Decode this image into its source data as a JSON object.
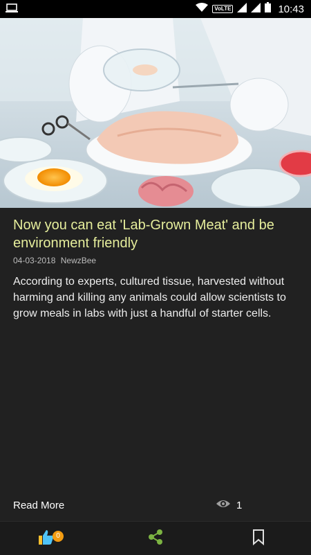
{
  "status_bar": {
    "time": "10:43",
    "network_badge": "VoLTE",
    "icons": [
      "screen-cast-icon",
      "wifi-icon",
      "signal-icon",
      "battery-icon"
    ]
  },
  "article": {
    "headline": "Now you can eat 'Lab-Grown Meat'  and be environment friendly",
    "date": "04-03-2018",
    "source": "NewzBee",
    "summary": "According to experts, cultured tissue, harvested without harming and killing any animals could allow scientists to grow meals in labs with just a handful of starter cells.",
    "read_more_label": "Read More",
    "view_count": "1",
    "hero_image": "lab-grown-meat-photo"
  },
  "bottom_bar": {
    "like_count": "0",
    "icons": [
      "thumbs-up-icon",
      "share-icon",
      "bookmark-icon"
    ]
  },
  "colors": {
    "background": "#212121",
    "headline": "#e6ee9c",
    "like_badge": "#f39c12",
    "share_accent": "#7cb342"
  }
}
